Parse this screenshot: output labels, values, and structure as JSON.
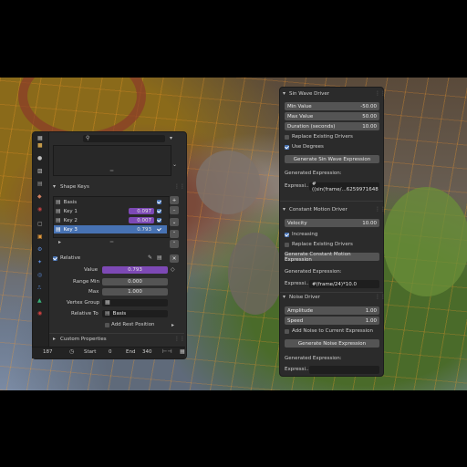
{
  "left_panel": {
    "shape_keys_title": "Shape Keys",
    "keys": [
      {
        "name": "Basis",
        "value": ""
      },
      {
        "name": "Key 1",
        "value": "0.097"
      },
      {
        "name": "Key 2",
        "value": "0.007"
      },
      {
        "name": "Key 3",
        "value": "0.793"
      }
    ],
    "relative_label": "Relative",
    "value_label": "Value",
    "value": "0.793",
    "range_min_label": "Range Min",
    "range_min": "0.000",
    "max_label": "Max",
    "max": "1.000",
    "vertex_group_label": "Vertex Group",
    "relative_to_label": "Relative To",
    "relative_to": "Basis",
    "add_rest_label": "Add Rest Position",
    "custom_props_label": "Custom Properties"
  },
  "timeline": {
    "frame": "187",
    "start_label": "Start",
    "start": "0",
    "end_label": "End",
    "end": "340"
  },
  "right_panel": {
    "sin": {
      "title": "Sin Wave Driver",
      "min_label": "Min Value",
      "min": "-50.00",
      "max_label": "Max Value",
      "max": "50.00",
      "duration_label": "Duration (seconds)",
      "duration": "10.00",
      "replace_label": "Replace Existing Drivers",
      "use_degrees_label": "Use Degrees",
      "generate_label": "Generate Sin Wave Expression",
      "gen_expr_label": "Generated Expression:",
      "expr_label": "Expressi...",
      "expr": "#((sin(frame/...6259971648"
    },
    "constant": {
      "title": "Constant Motion Driver",
      "velocity_label": "Velocity",
      "velocity": "10.00",
      "increasing_label": "Increasing",
      "replace_label": "Replace Existing Drivers",
      "generate_label": "Generate Constant Motion Expression",
      "gen_expr_label": "Generated Expression:",
      "expr_label": "Expressi...",
      "expr": "#(frame/24)*10.0"
    },
    "noise": {
      "title": "Noise Driver",
      "amplitude_label": "Amplitude",
      "amplitude": "1.00",
      "speed_label": "Speed",
      "speed": "1.00",
      "add_noise_label": "Add Noise to Current Expression",
      "generate_label": "Generate Noise Expression",
      "gen_expr_label": "Generated Expression:",
      "expr_label": "Expressi...",
      "expr": ""
    }
  },
  "colors": {
    "accent_blue": "#4772b3",
    "value_purple": "#7d49b5"
  }
}
